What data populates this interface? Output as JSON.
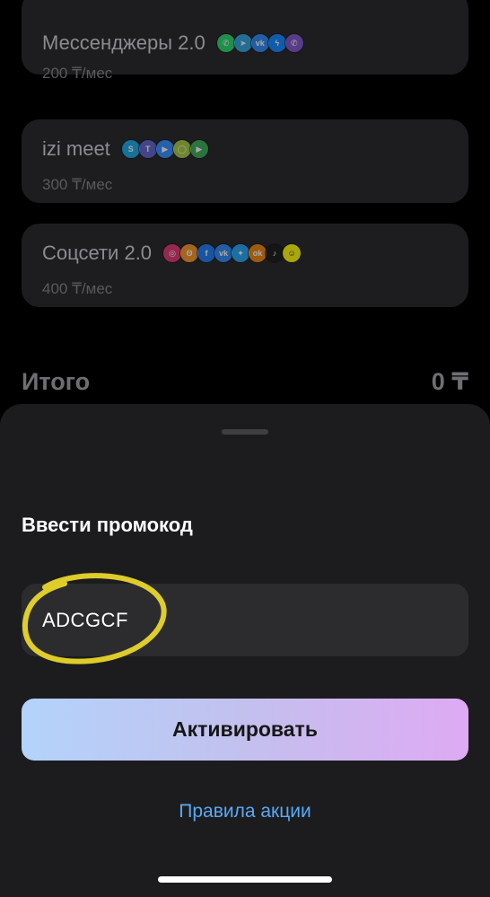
{
  "plans": [
    {
      "title": "Мессенджеры 2.0",
      "price": "200 ₸/мес",
      "icons": [
        {
          "name": "whatsapp-icon",
          "glyph": "✆",
          "color": "#25D366"
        },
        {
          "name": "telegram-icon",
          "glyph": "➤",
          "color": "#2AA1DA"
        },
        {
          "name": "vk-icon",
          "glyph": "vk",
          "color": "#2787F5"
        },
        {
          "name": "messenger-icon",
          "glyph": "ϟ",
          "color": "#0A84FF"
        },
        {
          "name": "viber-icon",
          "glyph": "✆",
          "color": "#7C50C7"
        }
      ]
    },
    {
      "title": "izi meet",
      "price": "300 ₸/мес",
      "icons": [
        {
          "name": "skype-icon",
          "glyph": "S",
          "color": "#11A6E4"
        },
        {
          "name": "teams-icon",
          "glyph": "T",
          "color": "#5B5FC7"
        },
        {
          "name": "zoom-icon",
          "glyph": "▶",
          "color": "#2D8CFF"
        },
        {
          "name": "webex-icon",
          "glyph": "◯",
          "color": "#A4C639"
        },
        {
          "name": "google-meet-icon",
          "glyph": "▶",
          "color": "#34A853"
        }
      ]
    },
    {
      "title": "Соцсети 2.0",
      "price": "400 ₸/мес",
      "icons": [
        {
          "name": "instagram-icon",
          "glyph": "◎",
          "color": "#E1306C"
        },
        {
          "name": "odnoklassniki-alt-icon",
          "glyph": "ʘ",
          "color": "#F7931E"
        },
        {
          "name": "facebook-icon",
          "glyph": "f",
          "color": "#1877F2"
        },
        {
          "name": "vk-icon",
          "glyph": "vk",
          "color": "#2787F5"
        },
        {
          "name": "twitter-icon",
          "glyph": "✦",
          "color": "#1DA1F2"
        },
        {
          "name": "odnoklassniki-icon",
          "glyph": "ok",
          "color": "#EE8208"
        },
        {
          "name": "tiktok-icon",
          "glyph": "♪",
          "color": "#111111"
        },
        {
          "name": "snapchat-icon",
          "glyph": "☺",
          "color": "#FFFC00"
        }
      ]
    }
  ],
  "total": {
    "label": "Итого",
    "value": "0 ₸"
  },
  "promo": {
    "title": "Ввести промокод",
    "value": "ADCGCF",
    "activate_label": "Активировать",
    "rules_label": "Правила акции"
  },
  "colors": {
    "accent_link": "#5AA9F4",
    "button_gradient_start": "#B3D3FB",
    "button_gradient_end": "#DEAAF3",
    "highlight": "#E8D62A"
  }
}
